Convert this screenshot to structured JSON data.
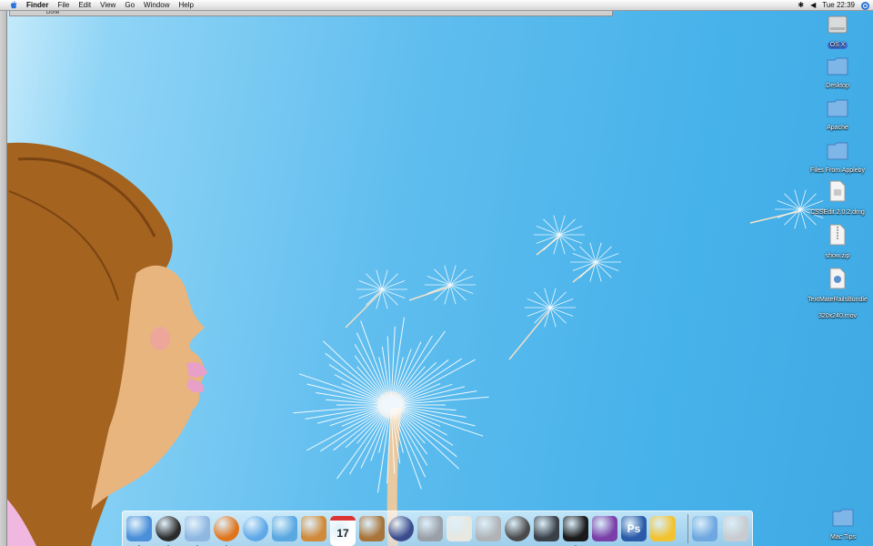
{
  "menubar": {
    "app": "Finder",
    "menus": [
      "File",
      "Edit",
      "View",
      "Go",
      "Window",
      "Help"
    ],
    "clock": "Tue 22:39"
  },
  "window": {
    "status": "Done"
  },
  "desktop_icons": [
    {
      "label": "OS X",
      "kind": "hard-drive-icon",
      "selected": true
    },
    {
      "label": "Desktop",
      "kind": "folder-icon"
    },
    {
      "label": "Apache",
      "kind": "folder-icon"
    },
    {
      "label": "Files From Appleby",
      "kind": "folder-icon"
    },
    {
      "label": "CSSEdit 2.0.2.dmg",
      "kind": "disk-image-icon"
    },
    {
      "label": "show.zip",
      "kind": "zip-icon"
    },
    {
      "label": "TextMateRailsBundle\n320x240.mov",
      "kind": "movie-icon"
    },
    {
      "label": "Mac Tips",
      "kind": "folder-icon"
    }
  ],
  "dock": {
    "apps": [
      {
        "name": "finder-icon",
        "color": "#4a8fd8",
        "running": true
      },
      {
        "name": "dashboard-icon",
        "color": "#2b2b2b",
        "running": true
      },
      {
        "name": "mail-icon",
        "color": "#8fb7e2",
        "running": true
      },
      {
        "name": "firefox-icon",
        "color": "#e0741c",
        "running": true
      },
      {
        "name": "safari-icon",
        "color": "#5fa8e8",
        "running": false
      },
      {
        "name": "itunes-icon",
        "color": "#5aa8e0",
        "running": false
      },
      {
        "name": "iphoto-icon",
        "color": "#d08a3a",
        "running": false
      },
      {
        "name": "ical-icon",
        "color": "#ffffff",
        "running": false,
        "text": "17"
      },
      {
        "name": "chess-icon",
        "color": "#a8743a",
        "running": false
      },
      {
        "name": "app-icon",
        "color": "#3b4b8c",
        "running": false
      },
      {
        "name": "calculator-icon",
        "color": "#9aa0a8",
        "running": false
      },
      {
        "name": "textedit-icon",
        "color": "#e8e8e0",
        "running": false
      },
      {
        "name": "disk-utility-icon",
        "color": "#b0b4b8",
        "running": false
      },
      {
        "name": "x11-icon",
        "color": "#4a4a4a",
        "running": false
      },
      {
        "name": "activity-monitor-icon",
        "color": "#3a4048",
        "running": false
      },
      {
        "name": "terminal-icon",
        "color": "#1a1a1a",
        "running": true
      },
      {
        "name": "textmate-icon",
        "color": "#7a3fa8",
        "running": false
      },
      {
        "name": "photoshop-icon",
        "color": "#2a5aa8",
        "running": false,
        "text": "Ps"
      },
      {
        "name": "cyberduck-icon",
        "color": "#f2c330",
        "running": false
      }
    ],
    "trailing": [
      {
        "name": "applications-folder-icon",
        "color": "#6fa8e0"
      },
      {
        "name": "trash-icon",
        "color": "#c8ccd0"
      }
    ]
  }
}
